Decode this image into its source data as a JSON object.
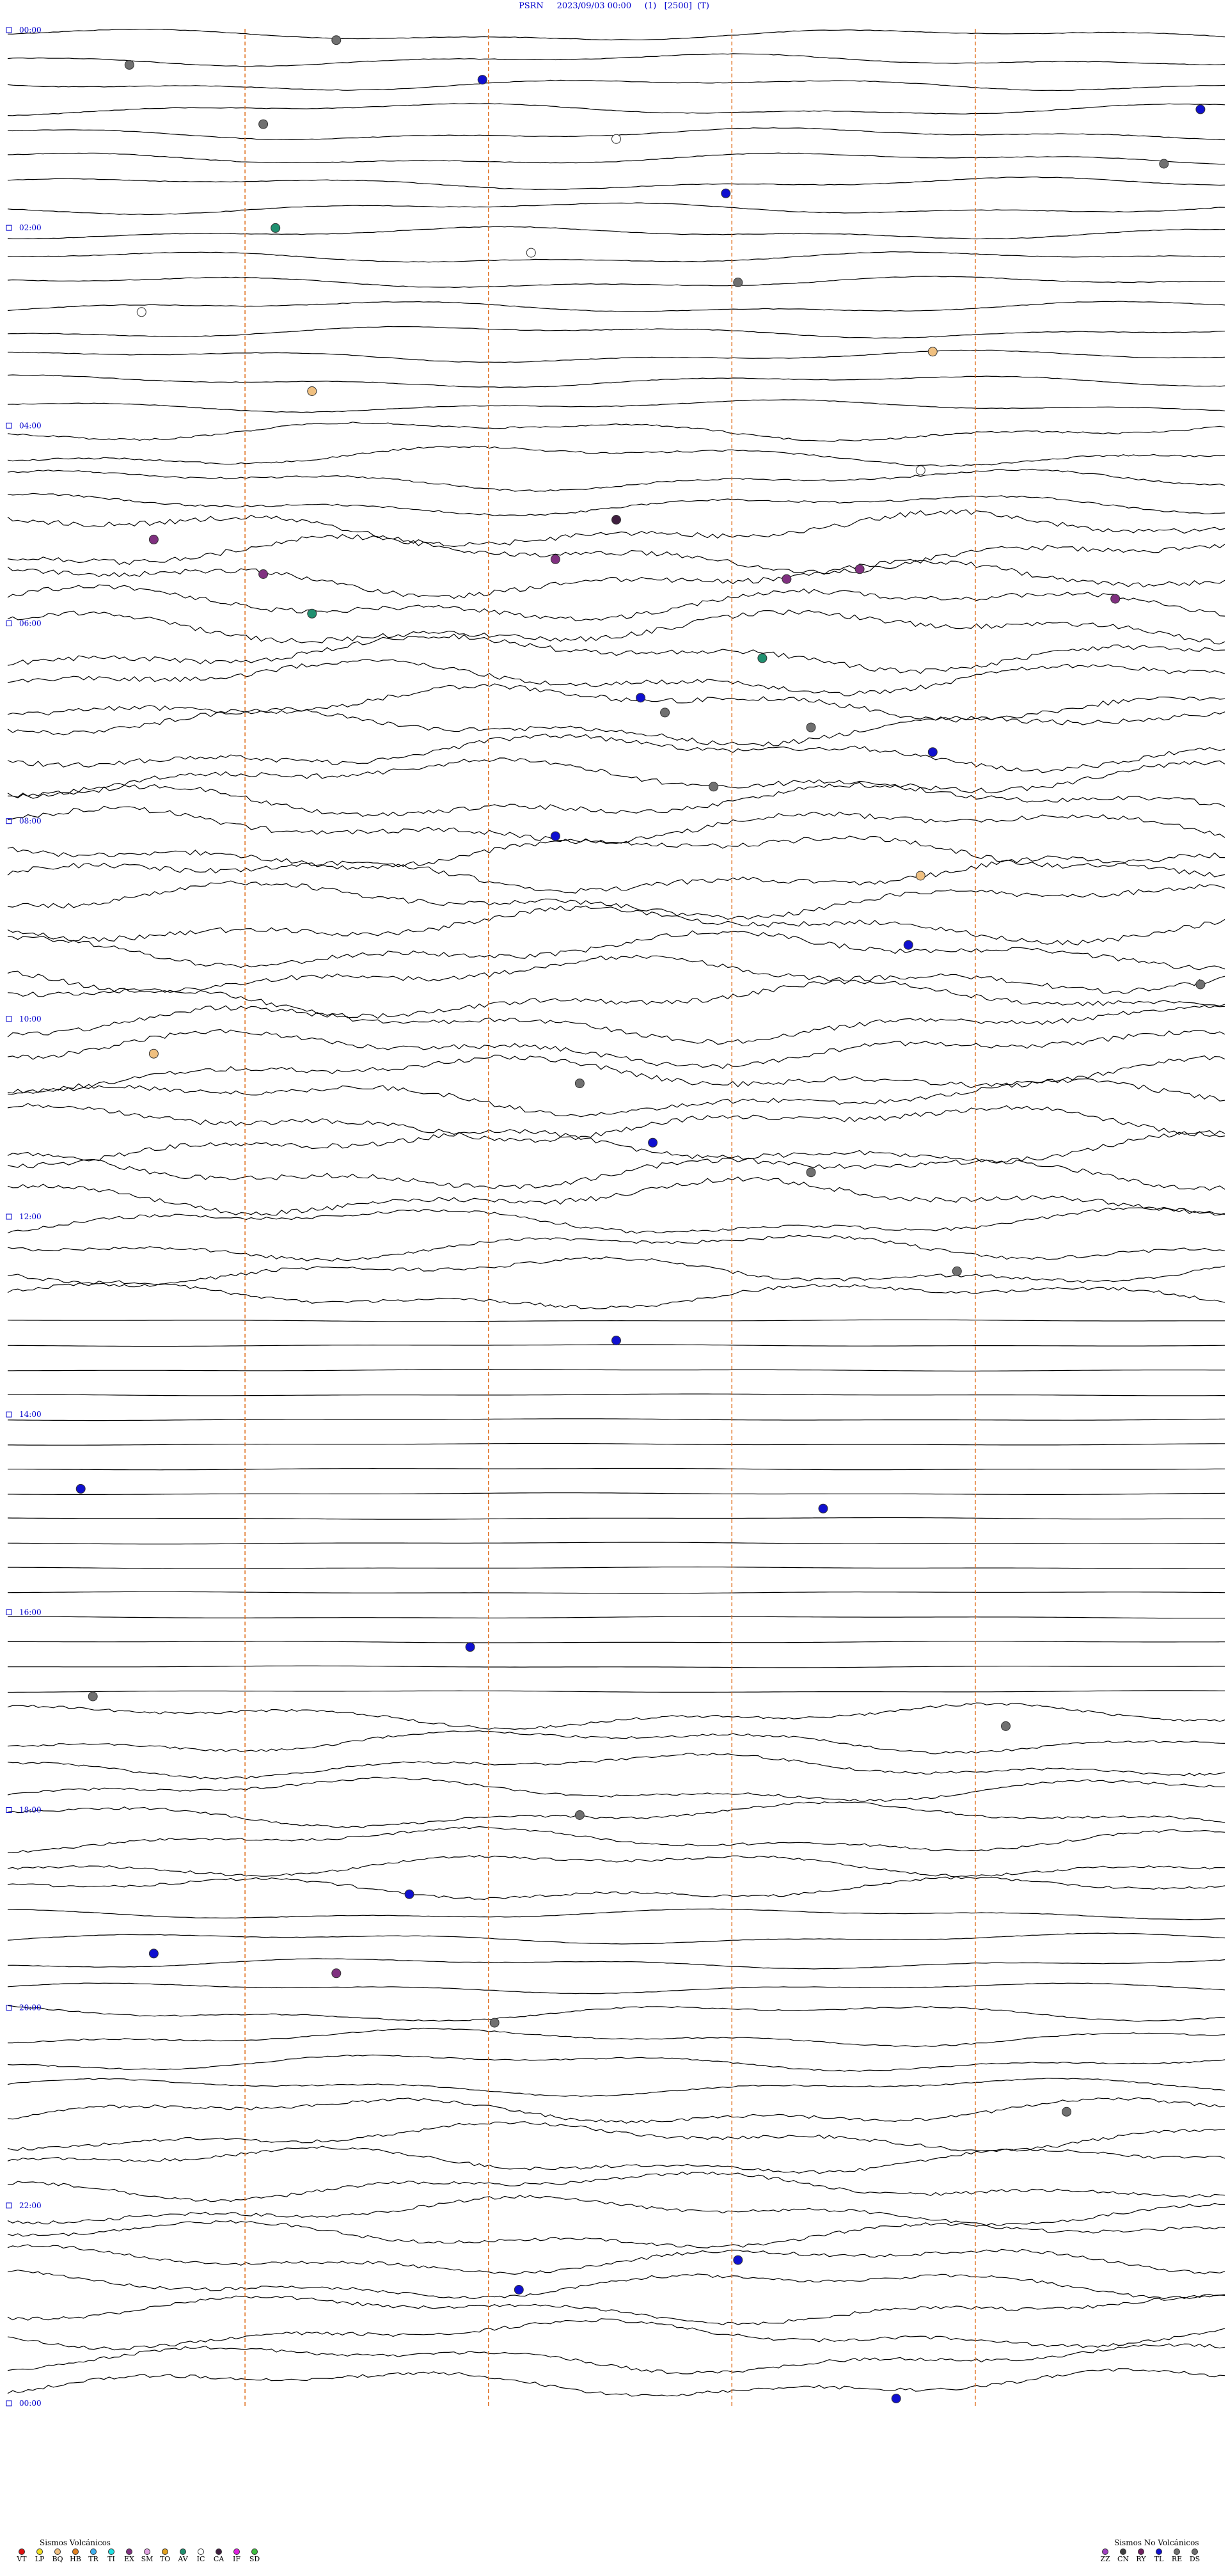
{
  "header": {
    "station": "PSRN",
    "datetime": "2023/09/03 00:00",
    "channel": "(1)",
    "gain": "[2500]",
    "mode": "(T)"
  },
  "chart_data": {
    "type": "helicorder",
    "lines_per_hour": 4,
    "hour_labels": [
      "00:00",
      "02:00",
      "04:00",
      "06:00",
      "08:00",
      "10:00",
      "12:00",
      "14:00",
      "16:00",
      "18:00",
      "20:00",
      "22:00",
      "00:00"
    ],
    "trace_color": "#000000",
    "marker_line_color": "#e07020",
    "label_color": "#0000cc",
    "events": [
      {
        "hour": 0.3,
        "fraction": 0.1,
        "type": "DS"
      },
      {
        "hour": 0.05,
        "fraction": 0.27,
        "type": "DS"
      },
      {
        "hour": 0.45,
        "fraction": 0.39,
        "type": "TL"
      },
      {
        "hour": 0.75,
        "fraction": 0.98,
        "type": "TL"
      },
      {
        "hour": 0.9,
        "fraction": 0.21,
        "type": "DS"
      },
      {
        "hour": 1.05,
        "fraction": 0.5,
        "type": "IC"
      },
      {
        "hour": 1.3,
        "fraction": 0.95,
        "type": "DS"
      },
      {
        "hour": 1.6,
        "fraction": 0.59,
        "type": "TL"
      },
      {
        "hour": 1.95,
        "fraction": 0.22,
        "type": "AV"
      },
      {
        "hour": 2.2,
        "fraction": 0.43,
        "type": "IC"
      },
      {
        "hour": 2.5,
        "fraction": 0.6,
        "type": "DS"
      },
      {
        "hour": 2.8,
        "fraction": 0.11,
        "type": "IC"
      },
      {
        "hour": 3.2,
        "fraction": 0.76,
        "type": "BQ"
      },
      {
        "hour": 3.6,
        "fraction": 0.25,
        "type": "BQ"
      },
      {
        "hour": 4.4,
        "fraction": 0.75,
        "type": "IC"
      },
      {
        "hour": 4.9,
        "fraction": 0.5,
        "type": "CA"
      },
      {
        "hour": 5.1,
        "fraction": 0.12,
        "type": "EX"
      },
      {
        "hour": 5.3,
        "fraction": 0.45,
        "type": "EX"
      },
      {
        "hour": 5.4,
        "fraction": 0.7,
        "type": "EX"
      },
      {
        "hour": 5.45,
        "fraction": 0.21,
        "type": "EX"
      },
      {
        "hour": 5.5,
        "fraction": 0.64,
        "type": "EX"
      },
      {
        "hour": 5.7,
        "fraction": 0.91,
        "type": "EX"
      },
      {
        "hour": 5.85,
        "fraction": 0.25,
        "type": "AV"
      },
      {
        "hour": 6.3,
        "fraction": 0.62,
        "type": "AV"
      },
      {
        "hour": 6.7,
        "fraction": 0.52,
        "type": "TL"
      },
      {
        "hour": 6.85,
        "fraction": 0.54,
        "type": "DS"
      },
      {
        "hour": 7.0,
        "fraction": 0.66,
        "type": "DS"
      },
      {
        "hour": 7.25,
        "fraction": 0.76,
        "type": "TL"
      },
      {
        "hour": 7.6,
        "fraction": 0.58,
        "type": "DS"
      },
      {
        "hour": 8.1,
        "fraction": 0.45,
        "type": "TL"
      },
      {
        "hour": 8.5,
        "fraction": 0.75,
        "type": "BQ"
      },
      {
        "hour": 9.2,
        "fraction": 0.74,
        "type": "TL"
      },
      {
        "hour": 9.6,
        "fraction": 0.98,
        "type": "DS"
      },
      {
        "hour": 10.3,
        "fraction": 0.12,
        "type": "BQ"
      },
      {
        "hour": 10.6,
        "fraction": 0.47,
        "type": "DS"
      },
      {
        "hour": 11.2,
        "fraction": 0.53,
        "type": "TL"
      },
      {
        "hour": 11.5,
        "fraction": 0.66,
        "type": "DS"
      },
      {
        "hour": 12.5,
        "fraction": 0.78,
        "type": "DS"
      },
      {
        "hour": 13.2,
        "fraction": 0.5,
        "type": "TL"
      },
      {
        "hour": 14.7,
        "fraction": 0.06,
        "type": "TL"
      },
      {
        "hour": 14.9,
        "fraction": 0.67,
        "type": "TL"
      },
      {
        "hour": 16.3,
        "fraction": 0.38,
        "type": "TL"
      },
      {
        "hour": 16.8,
        "fraction": 0.07,
        "type": "DS"
      },
      {
        "hour": 17.1,
        "fraction": 0.82,
        "type": "DS"
      },
      {
        "hour": 18.0,
        "fraction": 0.47,
        "type": "DS"
      },
      {
        "hour": 18.8,
        "fraction": 0.33,
        "type": "TL"
      },
      {
        "hour": 19.4,
        "fraction": 0.12,
        "type": "TL"
      },
      {
        "hour": 19.6,
        "fraction": 0.27,
        "type": "EX"
      },
      {
        "hour": 20.1,
        "fraction": 0.4,
        "type": "DS"
      },
      {
        "hour": 21.0,
        "fraction": 0.87,
        "type": "DS"
      },
      {
        "hour": 22.5,
        "fraction": 0.6,
        "type": "TL"
      },
      {
        "hour": 22.8,
        "fraction": 0.42,
        "type": "TL"
      },
      {
        "hour": 23.9,
        "fraction": 0.73,
        "type": "TL"
      }
    ]
  },
  "legend": {
    "volcanic_title": "Sismos Volcánicos",
    "volcanic": [
      {
        "code": "VT",
        "color": "#e01010"
      },
      {
        "code": "LP",
        "color": "#f0e020"
      },
      {
        "code": "BQ",
        "color": "#f0c080"
      },
      {
        "code": "HB",
        "color": "#e08020"
      },
      {
        "code": "TR",
        "color": "#40b0f0"
      },
      {
        "code": "TI",
        "color": "#20e0e0"
      },
      {
        "code": "EX",
        "color": "#803080"
      },
      {
        "code": "SM",
        "color": "#e0a0e0"
      },
      {
        "code": "TO",
        "color": "#e0a020"
      },
      {
        "code": "AV",
        "color": "#209070"
      },
      {
        "code": "IC",
        "color": "#ffffff"
      },
      {
        "code": "CA",
        "color": "#402040"
      },
      {
        "code": "IF",
        "color": "#e020e0"
      },
      {
        "code": "SD",
        "color": "#40c040"
      }
    ],
    "nonvolcanic_title": "Sismos No Volcánicos",
    "nonvolcanic": [
      {
        "code": "ZZ",
        "color": "#a040c0"
      },
      {
        "code": "CN",
        "color": "#404040"
      },
      {
        "code": "RY",
        "color": "#702060"
      },
      {
        "code": "TL",
        "color": "#1010d0"
      },
      {
        "code": "RE",
        "color": "#707070"
      },
      {
        "code": "DS",
        "color": "#707070"
      }
    ]
  }
}
